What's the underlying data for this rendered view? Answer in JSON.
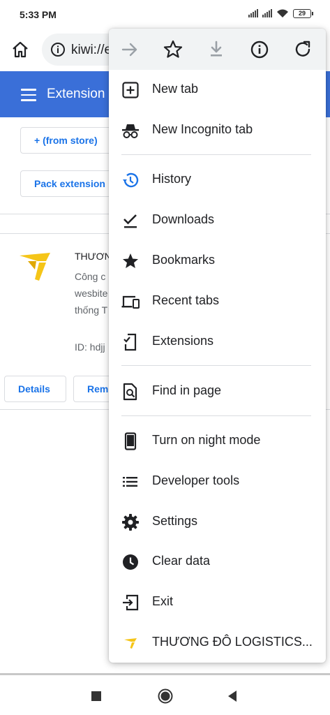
{
  "status_bar": {
    "time": "5:33 PM",
    "battery": "29"
  },
  "toolbar": {
    "url": "kiwi://e"
  },
  "page": {
    "header_title": "Extension",
    "from_store_label": "+ (from store)",
    "pack_extension_label": "Pack extension",
    "extension": {
      "name": "THƯƠN",
      "desc_line1": "Công c",
      "desc_line2": "wesbite",
      "desc_line3": "thống T",
      "id": "ID: hdjj"
    },
    "details_label": "Details",
    "remove_label": "Rem"
  },
  "menu": {
    "items": [
      {
        "label": "New tab",
        "icon": "plus-box-icon"
      },
      {
        "label": "New Incognito tab",
        "icon": "incognito-icon"
      },
      {
        "label": "History",
        "icon": "history-icon"
      },
      {
        "label": "Downloads",
        "icon": "downloads-check-icon"
      },
      {
        "label": "Bookmarks",
        "icon": "star-filled-icon"
      },
      {
        "label": "Recent tabs",
        "icon": "devices-icon"
      },
      {
        "label": "Extensions",
        "icon": "extensions-icon"
      },
      {
        "label": "Find in page",
        "icon": "find-in-page-icon"
      },
      {
        "label": "Turn on night mode",
        "icon": "phone-icon"
      },
      {
        "label": "Developer tools",
        "icon": "list-icon"
      },
      {
        "label": "Settings",
        "icon": "gear-icon"
      },
      {
        "label": "Clear data",
        "icon": "clock-icon"
      },
      {
        "label": "Exit",
        "icon": "exit-icon"
      },
      {
        "label": "THƯƠNG ĐÔ LOGISTICS...",
        "icon": "extension-logo-icon"
      }
    ]
  },
  "colors": {
    "brand_blue": "#3a6fd8",
    "link_blue": "#1a73e8",
    "logo_yellow": "#f5c518"
  }
}
